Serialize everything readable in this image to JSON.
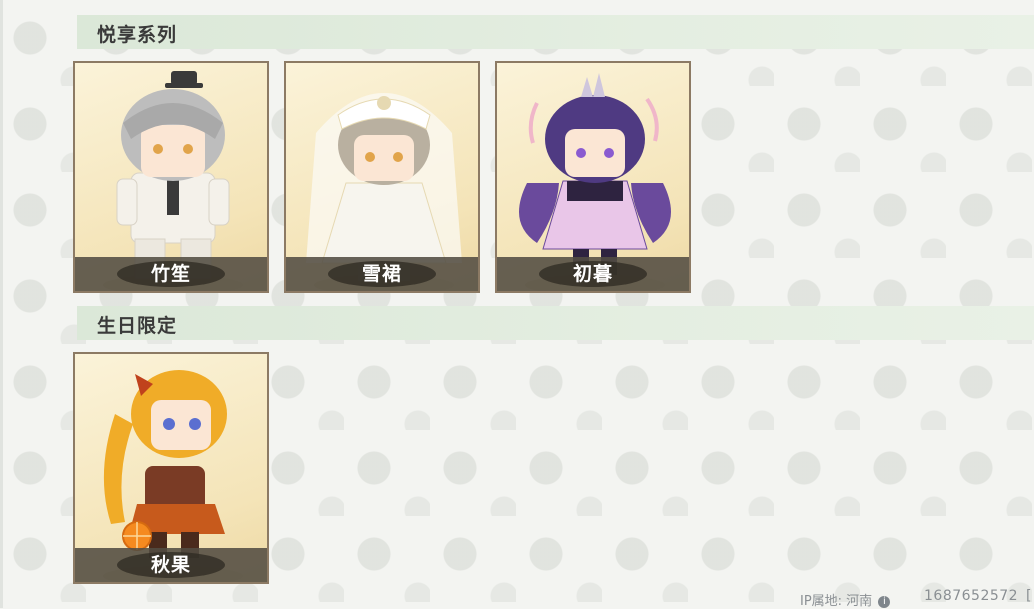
{
  "sections": [
    {
      "title": "悦享系列",
      "cards": [
        {
          "name": "竹笙",
          "theme": {
            "primary": "#f4f1ea",
            "hair": "#bdbdbd",
            "accent": "#3a3a3a"
          }
        },
        {
          "name": "雪裙",
          "theme": {
            "primary": "#f7f5ee",
            "hair": "#b9b0a0",
            "accent": "#e6d9b2"
          }
        },
        {
          "name": "初暮",
          "theme": {
            "primary": "#6a4a9c",
            "hair": "#4f3a82",
            "accent": "#f0b6c9"
          }
        }
      ]
    },
    {
      "title": "生日限定",
      "cards": [
        {
          "name": "秋果",
          "theme": {
            "primary": "#7a3b25",
            "hair": "#f0ac28",
            "accent": "#f58a1f"
          }
        }
      ]
    }
  ],
  "footer": {
    "ip_label": "IP属地: 河南",
    "ip_info": "i",
    "uid": "1687652572",
    "edge_glyph": "["
  },
  "colors": {
    "header_band": "#dbe8d8",
    "card_border": "#8c7a64",
    "name_bar": "#524c42"
  }
}
